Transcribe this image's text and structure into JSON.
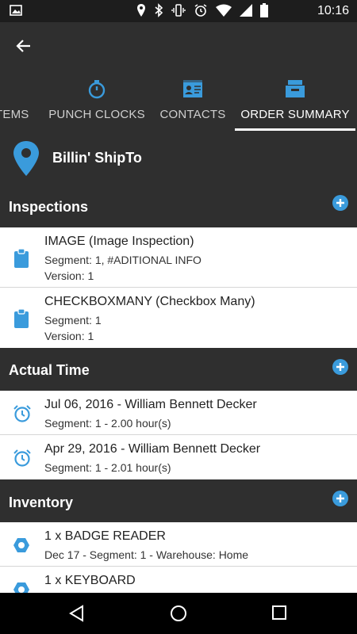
{
  "status": {
    "time": "10:16"
  },
  "tabs": [
    {
      "label": "TEMS",
      "icon": "none"
    },
    {
      "label": "PUNCH CLOCKS",
      "icon": "stopwatch-icon"
    },
    {
      "label": "CONTACTS",
      "icon": "contacts-icon"
    },
    {
      "label": "ORDER SUMMARY",
      "icon": "order-summary-icon",
      "active": true
    }
  ],
  "location": {
    "title": "Billin' ShipTo"
  },
  "inspections": {
    "title": "Inspections",
    "items": [
      {
        "title": "IMAGE (Image Inspection)",
        "segment": "Segment: 1, #ADITIONAL INFO",
        "version": "Version: 1"
      },
      {
        "title": "CHECKBOXMANY (Checkbox Many)",
        "segment": "Segment: 1",
        "version": "Version: 1"
      }
    ]
  },
  "actual_time": {
    "title": "Actual Time",
    "items": [
      {
        "title": "Jul 06, 2016 - William Bennett Decker",
        "detail": "Segment: 1 - 2.00 hour(s)"
      },
      {
        "title": "Apr 29, 2016 - William Bennett Decker",
        "detail": "Segment: 1 - 2.01 hour(s)"
      }
    ]
  },
  "inventory": {
    "title": "Inventory",
    "items": [
      {
        "title": "1 x BADGE READER",
        "detail": "Dec 17 - Segment: 1 - Warehouse: Home"
      },
      {
        "title": "1 x KEYBOARD"
      }
    ]
  },
  "colors": {
    "accent": "#3a9bdc",
    "header_bg": "#2f2f2f"
  }
}
